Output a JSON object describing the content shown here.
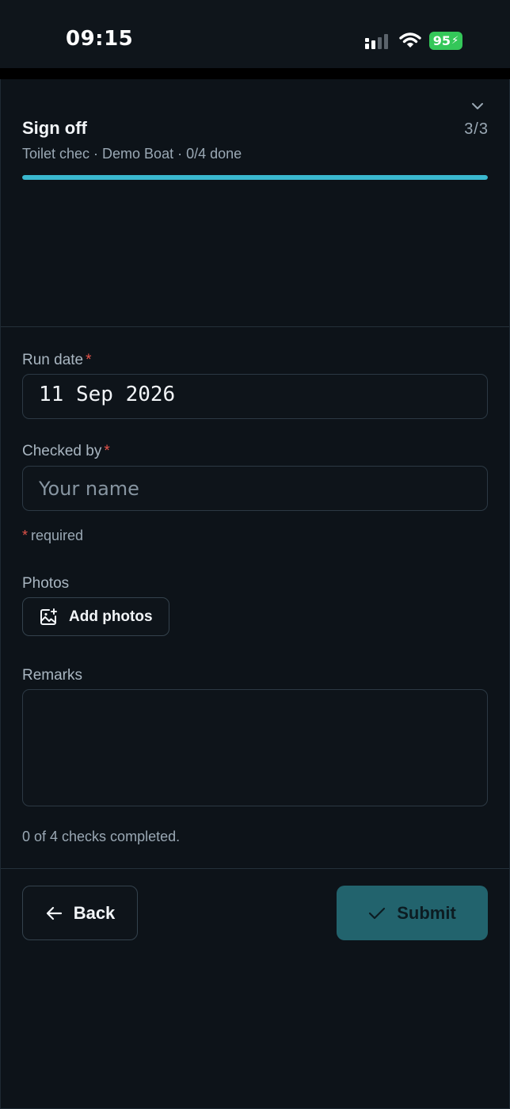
{
  "status_bar": {
    "time": "09:15",
    "battery_level": "95",
    "icons": [
      "signal-icon",
      "wifi-icon",
      "battery-charging-icon"
    ],
    "battery_color": "#34c759"
  },
  "header": {
    "title": "Sign off",
    "step": "3/3",
    "subtitle": "Toilet chec · Demo Boat · 0/4 done",
    "progress_fraction": 1.0,
    "progress_color": "#3ab8cf",
    "collapse_icon": "chevron-down-icon"
  },
  "form": {
    "run_date": {
      "label": "Run date",
      "required_marker": "*",
      "value": "11 Sep 2026"
    },
    "checked_by": {
      "label": "Checked by",
      "required_marker": "*",
      "value": "",
      "placeholder": "Your name"
    },
    "required_note": {
      "marker": "*",
      "text": "required"
    },
    "photos": {
      "label": "Photos",
      "button_label": "Add photos",
      "icon": "image-add-icon"
    },
    "remarks": {
      "label": "Remarks",
      "value": ""
    },
    "checks_status": "0 of 4 checks completed."
  },
  "footer": {
    "back_label": "Back",
    "back_icon": "arrow-left-icon",
    "submit_label": "Submit",
    "submit_icon": "check-icon",
    "submit_color": "#22636d"
  }
}
